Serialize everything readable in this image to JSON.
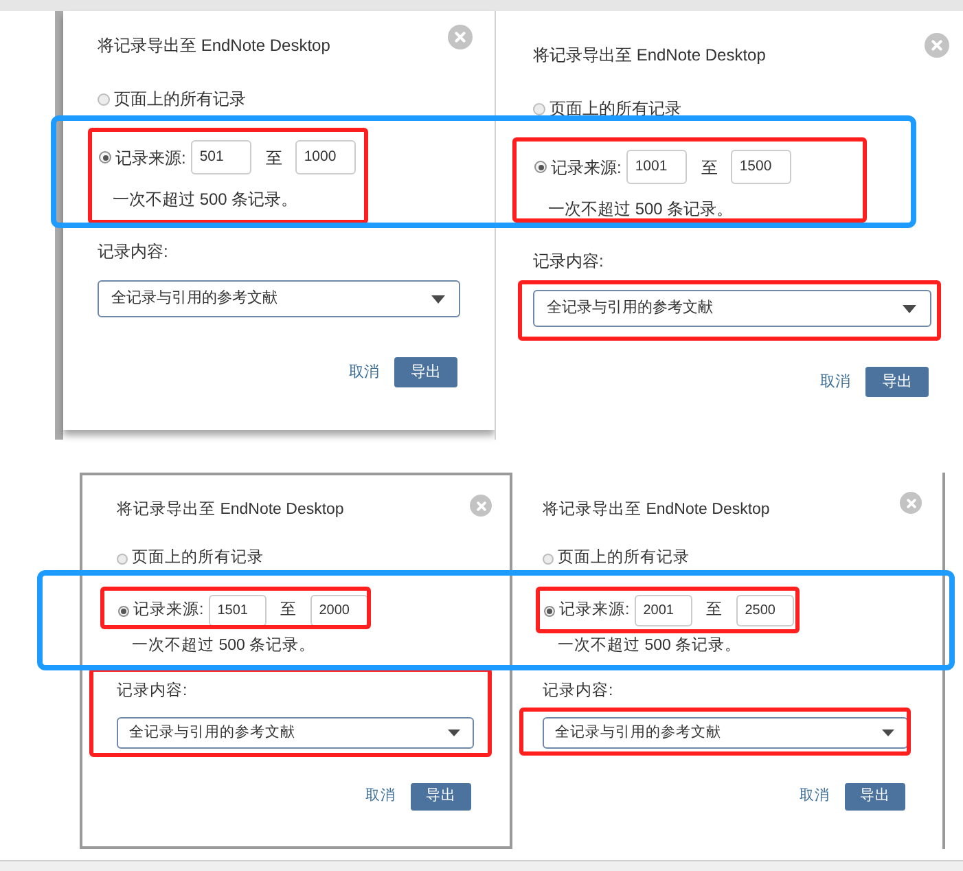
{
  "rows": [
    {
      "band": {
        "color": "#1e9bff"
      },
      "panels": [
        {
          "title": "将记录导出至 EndNote Desktop",
          "all_records": {
            "label": "页面上的所有记录",
            "selected": false
          },
          "range": {
            "label": "记录来源:",
            "selected": true,
            "from": "501",
            "separator": "至",
            "to": "1000",
            "note": "一次不超过 500 条记录。"
          },
          "content": {
            "label": "记录内容:",
            "value": "全记录与引用的参考文献"
          },
          "buttons": [
            {
              "label": "取消",
              "kind": "link"
            },
            {
              "label": "导出",
              "kind": "primary"
            }
          ],
          "annotations": [
            {
              "kind": "range-block",
              "color": "#ff1f1f"
            }
          ]
        },
        {
          "title": "将记录导出至 EndNote Desktop",
          "all_records": {
            "label": "页面上的所有记录",
            "selected": false
          },
          "range": {
            "label": "记录来源:",
            "selected": true,
            "from": "1001",
            "separator": "至",
            "to": "1500",
            "note": "一次不超过 500 条记录。"
          },
          "content": {
            "label": "记录内容:",
            "value": "全记录与引用的参考文献"
          },
          "buttons": [
            {
              "label": "取消",
              "kind": "link"
            },
            {
              "label": "导出",
              "kind": "primary"
            }
          ],
          "annotations": [
            {
              "kind": "range-block",
              "color": "#ff1f1f"
            },
            {
              "kind": "select",
              "color": "#ff1f1f"
            }
          ]
        }
      ]
    },
    {
      "band": {
        "color": "#1e9bff"
      },
      "panels": [
        {
          "title": "将记录导出至 EndNote Desktop",
          "all_records": {
            "label": "页面上的所有记录",
            "selected": false
          },
          "range": {
            "label": "记录来源:",
            "selected": true,
            "from": "1501",
            "separator": "至",
            "to": "2000",
            "note": "一次不超过 500 条记录。"
          },
          "content": {
            "label": "记录内容:",
            "value": "全记录与引用的参考文献"
          },
          "buttons": [
            {
              "label": "取消",
              "kind": "link"
            },
            {
              "label": "导出",
              "kind": "primary"
            }
          ],
          "annotations": [
            {
              "kind": "range-row",
              "color": "#ff1f1f"
            },
            {
              "kind": "content-block",
              "color": "#ff1f1f"
            }
          ]
        },
        {
          "title": "将记录导出至 EndNote Desktop",
          "all_records": {
            "label": "页面上的所有记录",
            "selected": false
          },
          "range": {
            "label": "记录来源:",
            "selected": true,
            "from": "2001",
            "separator": "至",
            "to": "2500",
            "note": "一次不超过 500 条记录。"
          },
          "content": {
            "label": "记录内容:",
            "value": "全记录与引用的参考文献"
          },
          "buttons": [
            {
              "label": "取消",
              "kind": "link"
            },
            {
              "label": "导出",
              "kind": "primary"
            }
          ],
          "annotations": [
            {
              "kind": "range-row",
              "color": "#ff1f1f"
            },
            {
              "kind": "select",
              "color": "#ff1f1f"
            }
          ]
        }
      ]
    }
  ]
}
